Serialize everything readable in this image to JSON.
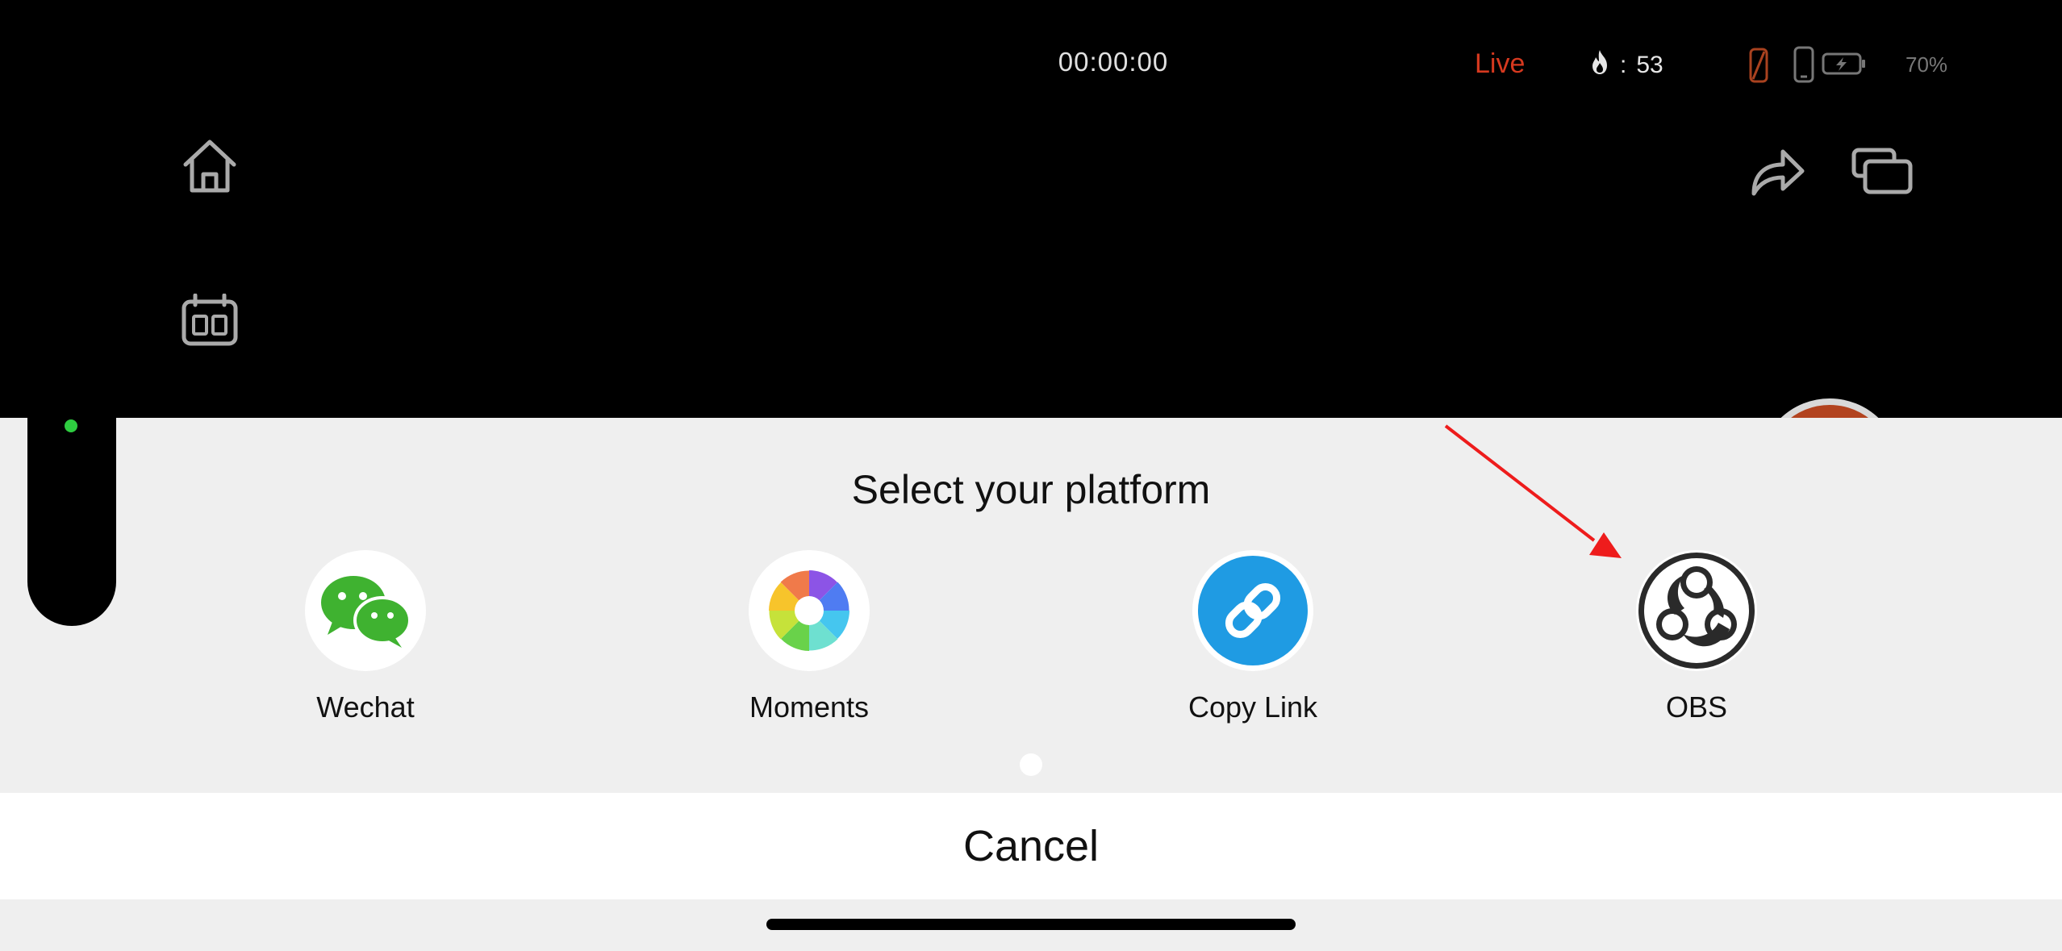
{
  "status": {
    "timer": "00:00:00",
    "live_label": "Live",
    "heat_count": "53",
    "heat_separator": ":",
    "battery_percent": "70%",
    "live_color": "#d6391f"
  },
  "toolbar": {
    "left_icons": [
      "home-icon",
      "calendar-icon"
    ],
    "right_icons": [
      "share-icon",
      "screens-icon"
    ]
  },
  "sheet": {
    "title": "Select your platform",
    "platforms": [
      {
        "label": "Wechat",
        "icon": "wechat-icon",
        "color": "#3fb230"
      },
      {
        "label": "Moments",
        "icon": "moments-icon"
      },
      {
        "label": "Copy Link",
        "icon": "link-icon",
        "color": "#1f9be3"
      },
      {
        "label": "OBS",
        "icon": "obs-icon",
        "color": "#2a2a2a"
      }
    ],
    "cancel_label": "Cancel"
  },
  "annotation": {
    "arrow_color": "#ee1c1c"
  }
}
